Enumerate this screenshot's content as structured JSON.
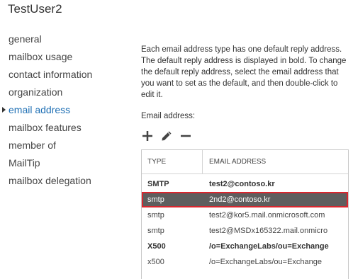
{
  "page": {
    "title": "TestUser2"
  },
  "nav": {
    "items": [
      {
        "label": "general",
        "selected": false
      },
      {
        "label": "mailbox usage",
        "selected": false
      },
      {
        "label": "contact information",
        "selected": false
      },
      {
        "label": "organization",
        "selected": false
      },
      {
        "label": "email address",
        "selected": true
      },
      {
        "label": "mailbox features",
        "selected": false
      },
      {
        "label": "member of",
        "selected": false
      },
      {
        "label": "MailTip",
        "selected": false
      },
      {
        "label": "mailbox delegation",
        "selected": false
      }
    ]
  },
  "content": {
    "description": "Each email address type has one default reply address. The default reply address is displayed in bold. To change the default reply address, select the email address that you want to set as the default, and then double-click to edit it.",
    "email_label": "Email address:",
    "toolbar": {
      "add_icon": "plus-icon",
      "edit_icon": "pencil-icon",
      "remove_icon": "minus-icon"
    },
    "grid": {
      "columns": [
        "TYPE",
        "EMAIL ADDRESS"
      ],
      "rows": [
        {
          "type": "SMTP",
          "address": "test2@contoso.kr",
          "bold": true,
          "selected": false
        },
        {
          "type": "smtp",
          "address": "2nd2@contoso.kr",
          "bold": false,
          "selected": true
        },
        {
          "type": "smtp",
          "address": "test2@kor5.mail.onmicrosoft.com",
          "bold": false,
          "selected": false
        },
        {
          "type": "smtp",
          "address": "test2@MSDx165322.mail.onmicro",
          "bold": false,
          "selected": false
        },
        {
          "type": "X500",
          "address": "/o=ExchangeLabs/ou=Exchange",
          "bold": true,
          "selected": false
        },
        {
          "type": "x500",
          "address": "/o=ExchangeLabs/ou=Exchange",
          "bold": false,
          "selected": false
        }
      ]
    }
  },
  "colors": {
    "accent": "#1e6fb4",
    "selected_row": "#5e5e5e",
    "highlight_border": "#d9262e"
  }
}
